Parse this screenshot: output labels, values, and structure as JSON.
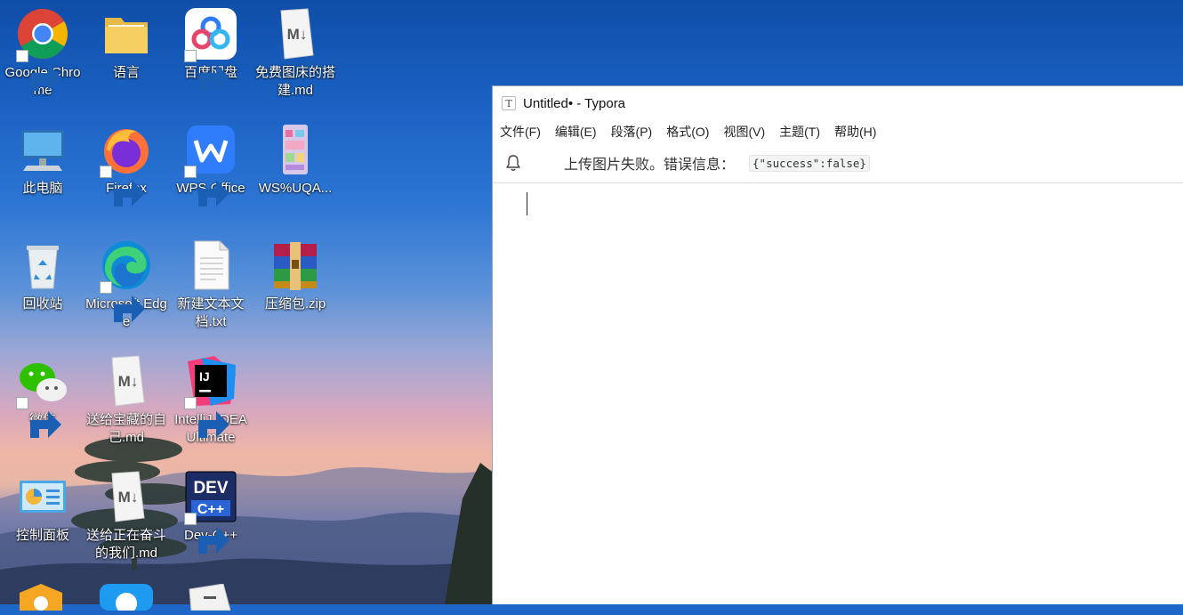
{
  "desktop": {
    "icons": [
      {
        "label": "Google Chrome",
        "icon": "chrome-icon"
      },
      {
        "label": "语言",
        "icon": "folder-icon"
      },
      {
        "label": "百度网盘",
        "icon": "baidu-netdisk-icon"
      },
      {
        "label": "免费图床的搭建.md",
        "icon": "markdown-file-icon"
      },
      {
        "label": "此电脑",
        "icon": "this-pc-icon"
      },
      {
        "label": "Firefox",
        "icon": "firefox-icon"
      },
      {
        "label": "WPS Office",
        "icon": "wps-office-icon"
      },
      {
        "label": "WS%UQA...",
        "icon": "image-file-icon"
      },
      {
        "label": "回收站",
        "icon": "recycle-bin-icon"
      },
      {
        "label": "Microsoft Edge",
        "icon": "edge-icon"
      },
      {
        "label": "新建文本文档.txt",
        "icon": "text-file-icon"
      },
      {
        "label": "压缩包.zip",
        "icon": "winrar-archive-icon"
      },
      {
        "label": "微信",
        "icon": "wechat-icon"
      },
      {
        "label": "送给宝藏的自己.md",
        "icon": "markdown-file-icon"
      },
      {
        "label": "IntelliJ IDEA Ultimate",
        "icon": "intellij-idea-icon"
      },
      {
        "label": "控制面板",
        "icon": "control-panel-icon"
      },
      {
        "label": "送给正在奋斗的我们.md",
        "icon": "markdown-file-icon"
      },
      {
        "label": "Dev-C++",
        "icon": "dev-cpp-icon"
      }
    ]
  },
  "typora": {
    "title": "Untitled• - Typora",
    "logo_letter": "T",
    "menu": [
      "文件(F)",
      "编辑(E)",
      "段落(P)",
      "格式(O)",
      "视图(V)",
      "主题(T)",
      "帮助(H)"
    ],
    "notice": {
      "message": "上传图片失败。错误信息：",
      "code": "{\"success\":false}"
    }
  },
  "colors": {
    "wallpaper_sky": "#1f66c9",
    "window_bg": "#ffffff",
    "label_text": "#ffffff"
  }
}
